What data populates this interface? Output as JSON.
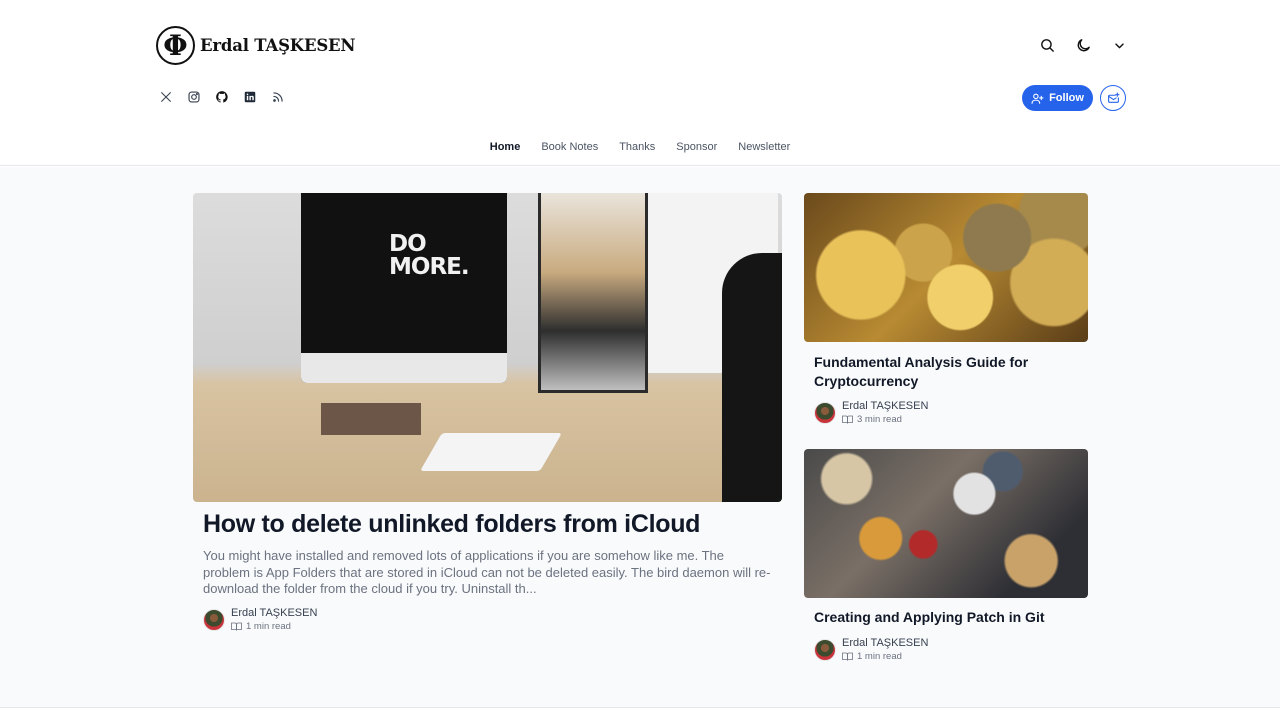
{
  "site": {
    "logo_glyph": "Φ",
    "name": "Erdal TAŞKESEN"
  },
  "header": {
    "top_icons": [
      "search-icon",
      "moon-icon",
      "chevron-down-icon"
    ],
    "socials": [
      "x-icon",
      "instagram-icon",
      "github-icon",
      "linkedin-icon",
      "rss-icon"
    ],
    "follow_label": "Follow",
    "newsletter_icon": "mail-plus-icon"
  },
  "nav": {
    "items": [
      {
        "label": "Home",
        "active": true
      },
      {
        "label": "Book Notes",
        "active": false
      },
      {
        "label": "Thanks",
        "active": false
      },
      {
        "label": "Sponsor",
        "active": false
      },
      {
        "label": "Newsletter",
        "active": false
      }
    ]
  },
  "featured": {
    "image_text": [
      "DO",
      "MORE."
    ],
    "title": "How to delete unlinked folders from iCloud",
    "excerpt": "You might have installed and removed lots of applications if you are somehow like me. The problem is App Folders that are stored in iCloud can not be deleted easily. The bird daemon will re-download the folder from the cloud if you try. Uninstall th...",
    "author": "Erdal TAŞKESEN",
    "read_time": "1 min read"
  },
  "posts": [
    {
      "title": "Fundamental Analysis Guide for Cryptocurrency",
      "author": "Erdal TAŞKESEN",
      "read_time": "3 min read"
    },
    {
      "title": "Creating and Applying Patch in Git",
      "author": "Erdal TAŞKESEN",
      "read_time": "1 min read"
    }
  ],
  "colors": {
    "accent": "#2563eb",
    "text": "#111827",
    "muted": "#6b7280",
    "background": "#f9fafb"
  }
}
